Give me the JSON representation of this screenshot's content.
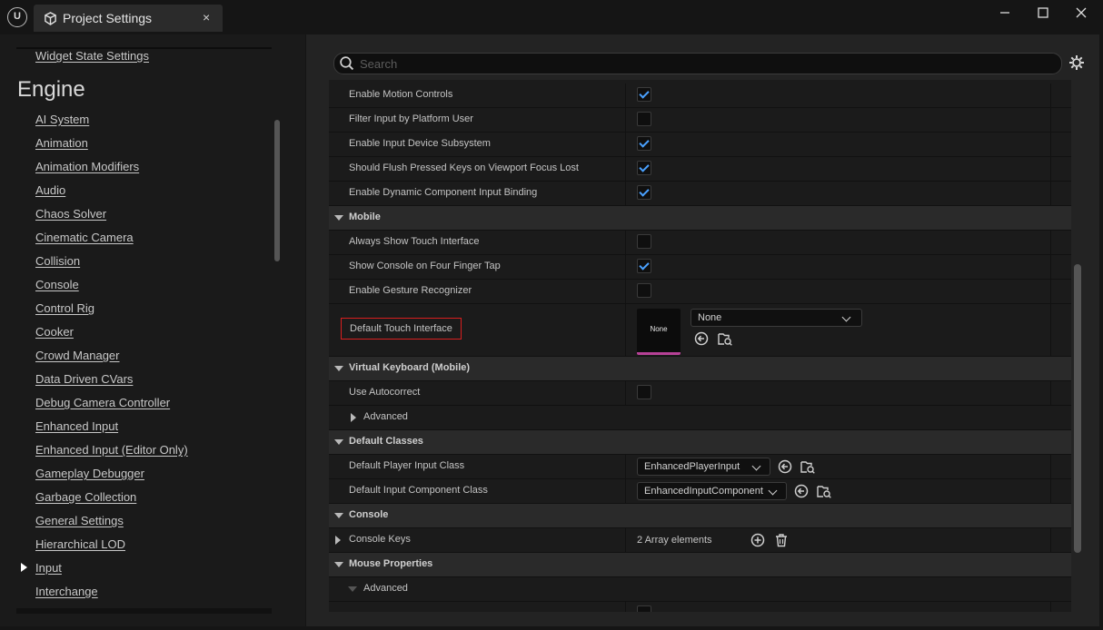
{
  "window": {
    "tab_title": "Project Settings",
    "logo_label": "U"
  },
  "sidebar": {
    "top_item": "Widget State Settings",
    "heading": "Engine",
    "items": [
      "AI System",
      "Animation",
      "Animation Modifiers",
      "Audio",
      "Chaos Solver",
      "Cinematic Camera",
      "Collision",
      "Console",
      "Control Rig",
      "Cooker",
      "Crowd Manager",
      "Data Driven CVars",
      "Debug Camera Controller",
      "Enhanced Input",
      "Enhanced Input (Editor Only)",
      "Gameplay Debugger",
      "Garbage Collection",
      "General Settings",
      "Hierarchical LOD",
      "Input",
      "Interchange"
    ],
    "active_item": "Input"
  },
  "search": {
    "placeholder": "Search"
  },
  "rows": {
    "enable_motion_controls": "Enable Motion Controls",
    "filter_input_by_platform_user": "Filter Input by Platform User",
    "enable_input_device_subsystem": "Enable Input Device Subsystem",
    "should_flush_pressed_keys": "Should Flush Pressed Keys on Viewport Focus Lost",
    "enable_dynamic_component_input_binding": "Enable Dynamic Component Input Binding",
    "mobile": "Mobile",
    "always_show_touch_interface": "Always Show Touch Interface",
    "show_console_on_four_finger_tap": "Show Console on Four Finger Tap",
    "enable_gesture_recognizer": "Enable Gesture Recognizer",
    "default_touch_interface": "Default Touch Interface",
    "touch_interface_thumb": "None",
    "touch_interface_value": "None",
    "virtual_keyboard": "Virtual Keyboard (Mobile)",
    "use_autocorrect": "Use Autocorrect",
    "advanced": "Advanced",
    "default_classes": "Default Classes",
    "default_player_input_class": "Default Player Input Class",
    "player_input_value": "EnhancedPlayerInput",
    "default_input_component_class": "Default Input Component Class",
    "input_component_value": "EnhancedInputComponent",
    "console": "Console",
    "console_keys": "Console Keys",
    "console_keys_value": "2 Array elements",
    "mouse_properties": "Mouse Properties",
    "mouse_advanced": "Advanced"
  },
  "checkboxes": {
    "enable_motion_controls": true,
    "filter_input_by_platform_user": false,
    "enable_input_device_subsystem": true,
    "should_flush_pressed_keys": true,
    "enable_dynamic_component_input_binding": true,
    "always_show_touch_interface": false,
    "show_console_on_four_finger_tap": true,
    "enable_gesture_recognizer": false,
    "use_autocorrect": false
  },
  "colors": {
    "accent_check": "#4aa1ff",
    "highlight_box": "#d81f1f",
    "asset_underline": "#b64196"
  }
}
